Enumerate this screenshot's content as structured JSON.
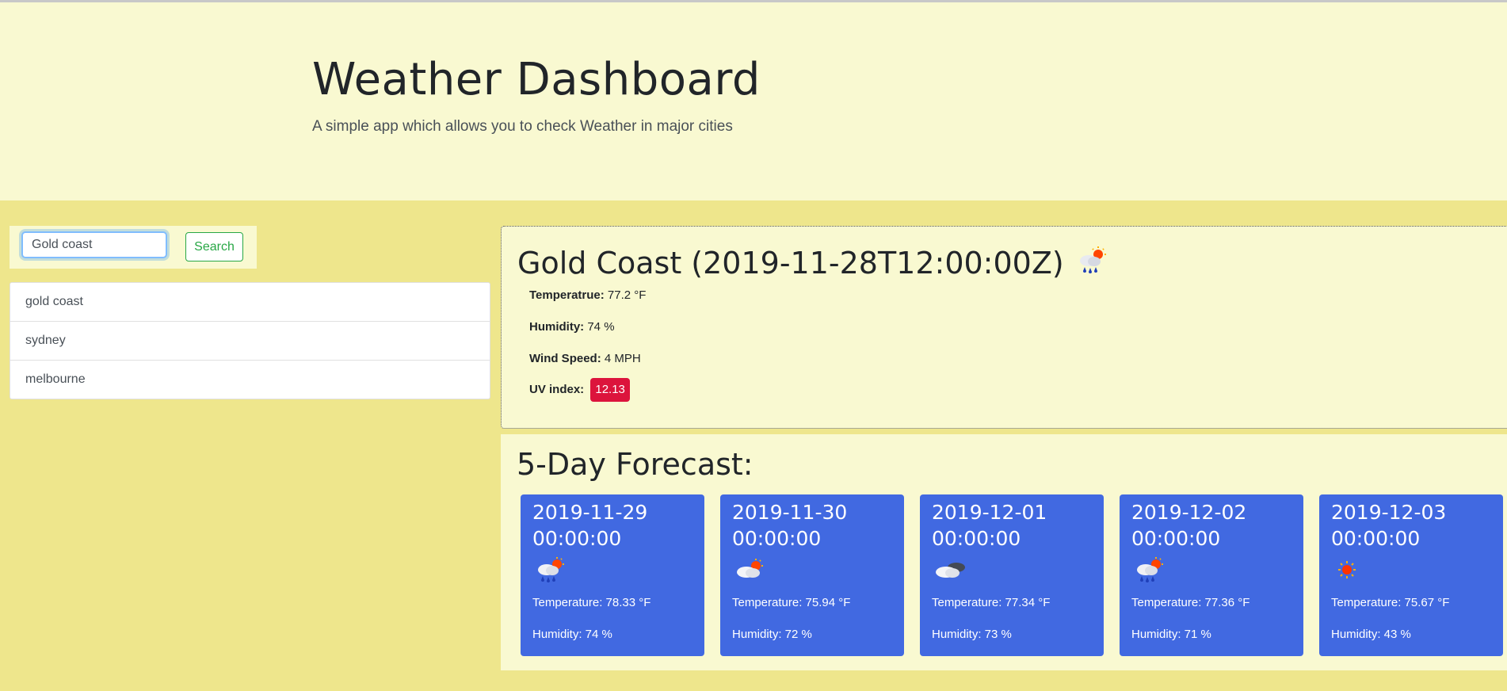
{
  "header": {
    "title": "Weather Dashboard",
    "subtitle": "A simple app which allows you to check Weather in major cities"
  },
  "search": {
    "value": "Gold coast",
    "button_label": "Search"
  },
  "history": [
    "gold coast",
    "sydney",
    "melbourne"
  ],
  "current": {
    "heading": "Gold Coast (2019-11-28T12:00:00Z)",
    "icon": "rain-sun-icon",
    "temperature_label": "Temperatrue:",
    "temperature_value": "77.2 °F",
    "humidity_label": "Humidity:",
    "humidity_value": "74 %",
    "wind_label": "Wind Speed:",
    "wind_value": "4 MPH",
    "uv_label": "UV index:",
    "uv_value": "12.13",
    "uv_color": "#dc143c"
  },
  "forecast": {
    "title": "5-Day Forecast:",
    "card_color": "#4169e1",
    "days": [
      {
        "date": "2019-11-29 00:00:00",
        "icon": "rain-sun-icon",
        "temperature": "Temperature: 78.33 °F",
        "humidity": "Humidity: 74 %"
      },
      {
        "date": "2019-11-30 00:00:00",
        "icon": "cloud-sun-icon",
        "temperature": "Temperature: 75.94 °F",
        "humidity": "Humidity: 72 %"
      },
      {
        "date": "2019-12-01 00:00:00",
        "icon": "clouds-icon",
        "temperature": "Temperature: 77.34 °F",
        "humidity": "Humidity: 73 %"
      },
      {
        "date": "2019-12-02 00:00:00",
        "icon": "rain-sun-icon",
        "temperature": "Temperature: 77.36 °F",
        "humidity": "Humidity: 71 %"
      },
      {
        "date": "2019-12-03 00:00:00",
        "icon": "sun-icon",
        "temperature": "Temperature: 75.67 °F",
        "humidity": "Humidity: 43 %"
      }
    ]
  }
}
